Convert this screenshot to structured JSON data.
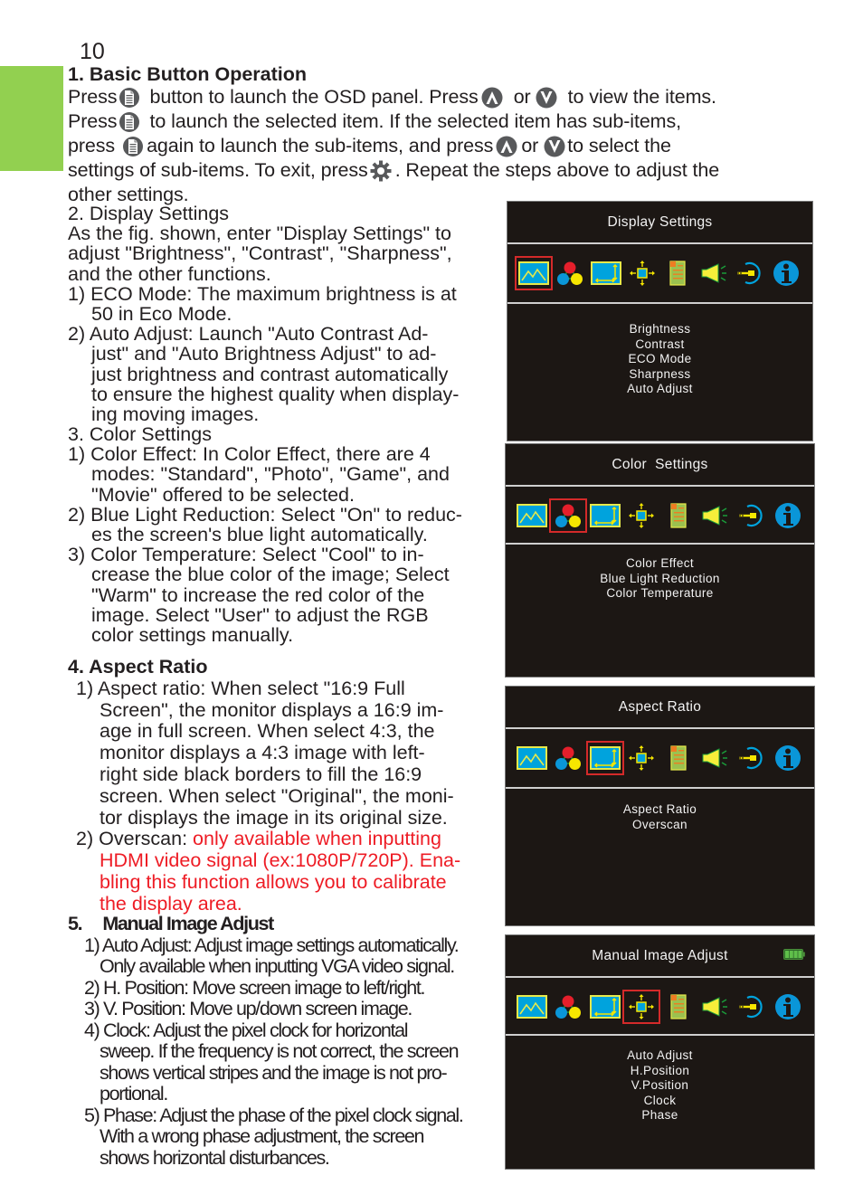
{
  "page_number": "10",
  "colors": {
    "green_tab": "#92d050",
    "red_text": "#ee1c25",
    "osd_bg": "#1c1714",
    "selection": "#d42a2a"
  },
  "section1": {
    "heading": "1.  Basic Button Operation",
    "line1": {
      "a": "Press",
      "b": "button to launch the OSD panel. Press",
      "c": "or",
      "d": "to view the items."
    },
    "line2": {
      "a": "Press",
      "b": "to launch the selected item. If the selected item has sub-items,"
    },
    "line3": {
      "a": "press",
      "b": "again to launch the sub-items, and press",
      "c": "or",
      "d": "to select the"
    },
    "line4": {
      "a": "settings of sub-items. To exit, press",
      "b": ". Repeat the steps above to adjust the"
    },
    "line5": "other settings.",
    "icons": {
      "menu": "menu-button-icon",
      "up": "up-button-icon",
      "down": "down-button-icon",
      "exit": "gear-icon"
    }
  },
  "section2": {
    "heading": "2.   Display Settings",
    "intro": [
      "As the fig. shown, enter \"Display Settings\" to",
      "adjust \"Brightness\", \"Contrast\",  \"Sharpness\",",
      "and the other functions."
    ],
    "items": [
      [
        "1)  ECO Mode: The maximum brightness is at",
        "50 in Eco Mode."
      ],
      [
        "2) Auto Adjust: Launch \"Auto Contrast Ad-",
        "just\" and \"Auto Brightness Adjust\" to ad-",
        "just brightness and contrast automatically",
        "to ensure the highest quality when display-",
        "ing moving images."
      ]
    ]
  },
  "section3": {
    "heading": "3.   Color Settings",
    "items": [
      [
        "1) Color Effect: In Color Effect, there are 4",
        "modes: \"Standard\", \"Photo\", \"Game\", and",
        "\"Movie\" offered to be selected."
      ],
      [
        "2) Blue Light Reduction: Select \"On\" to reduc-",
        "es the screen's blue light automatically."
      ],
      [
        "3) Color Temperature: Select \"Cool\" to in-",
        "crease the blue color of the image; Select",
        "\"Warm\" to increase the red color of the",
        "image. Select \"User\" to adjust the RGB",
        "color settings manually."
      ]
    ]
  },
  "section4": {
    "heading": "4.   Aspect Ratio",
    "item1": [
      "1) Aspect ratio: When select \"16:9 Full",
      "Screen\", the monitor displays a 16:9 im-",
      "age in full screen. When select 4:3, the",
      "monitor displays a 4:3 image with left-",
      "right side black borders to fill the 16:9",
      "screen. When select \"Original\", the moni-",
      "tor displays the image in its original size."
    ],
    "item2_prefix": "2) Overscan: ",
    "item2_red": [
      "only available when inputting",
      "HDMI video signal (ex:1080P/720P). Ena-",
      "bling this function allows you to calibrate",
      "the display area."
    ]
  },
  "section5": {
    "heading": "5.     Manual Image Adjust",
    "items": [
      [
        "1) Auto Adjust: Adjust image settings automatically.",
        "Only available when inputting VGA video signal."
      ],
      [
        "2) H. Position: Move screen image to left/right."
      ],
      [
        "3) V. Position: Move up/down screen image."
      ],
      [
        "4) Clock:  Adjust the pixel clock for horizontal",
        "sweep. If the frequency is not correct, the screen",
        "shows vertical stripes and the image is not pro-",
        "portional."
      ],
      [
        "5) Phase: Adjust the phase of the pixel clock signal.",
        "With a wrong phase adjustment, the screen",
        "shows horizontal disturbances."
      ]
    ]
  },
  "osd_icons": [
    "picture-icon",
    "color-icon",
    "aspect-ratio-icon",
    "image-position-icon",
    "osd-document-icon",
    "audio-speaker-icon",
    "input-source-icon",
    "information-icon"
  ],
  "osd_panels": [
    {
      "title": "Display Settings",
      "selected_icon": "picture-icon",
      "items": [
        "Brightness",
        "Contrast",
        "ECO Mode",
        "Sharpness",
        "Auto Adjust"
      ]
    },
    {
      "title": "Color  Settings",
      "selected_icon": "color-icon",
      "items": [
        "Color Effect",
        "Blue Light Reduction",
        "Color Temperature"
      ]
    },
    {
      "title": "Aspect Ratio",
      "selected_icon": "aspect-ratio-icon",
      "items": [
        "Aspect Ratio",
        "Overscan"
      ]
    },
    {
      "title": "Manual Image Adjust",
      "selected_icon": "image-position-icon",
      "items": [
        "Auto Adjust",
        "H.Position",
        "V.Position",
        "Clock",
        "Phase"
      ],
      "battery_icon": "battery-full-icon"
    }
  ]
}
